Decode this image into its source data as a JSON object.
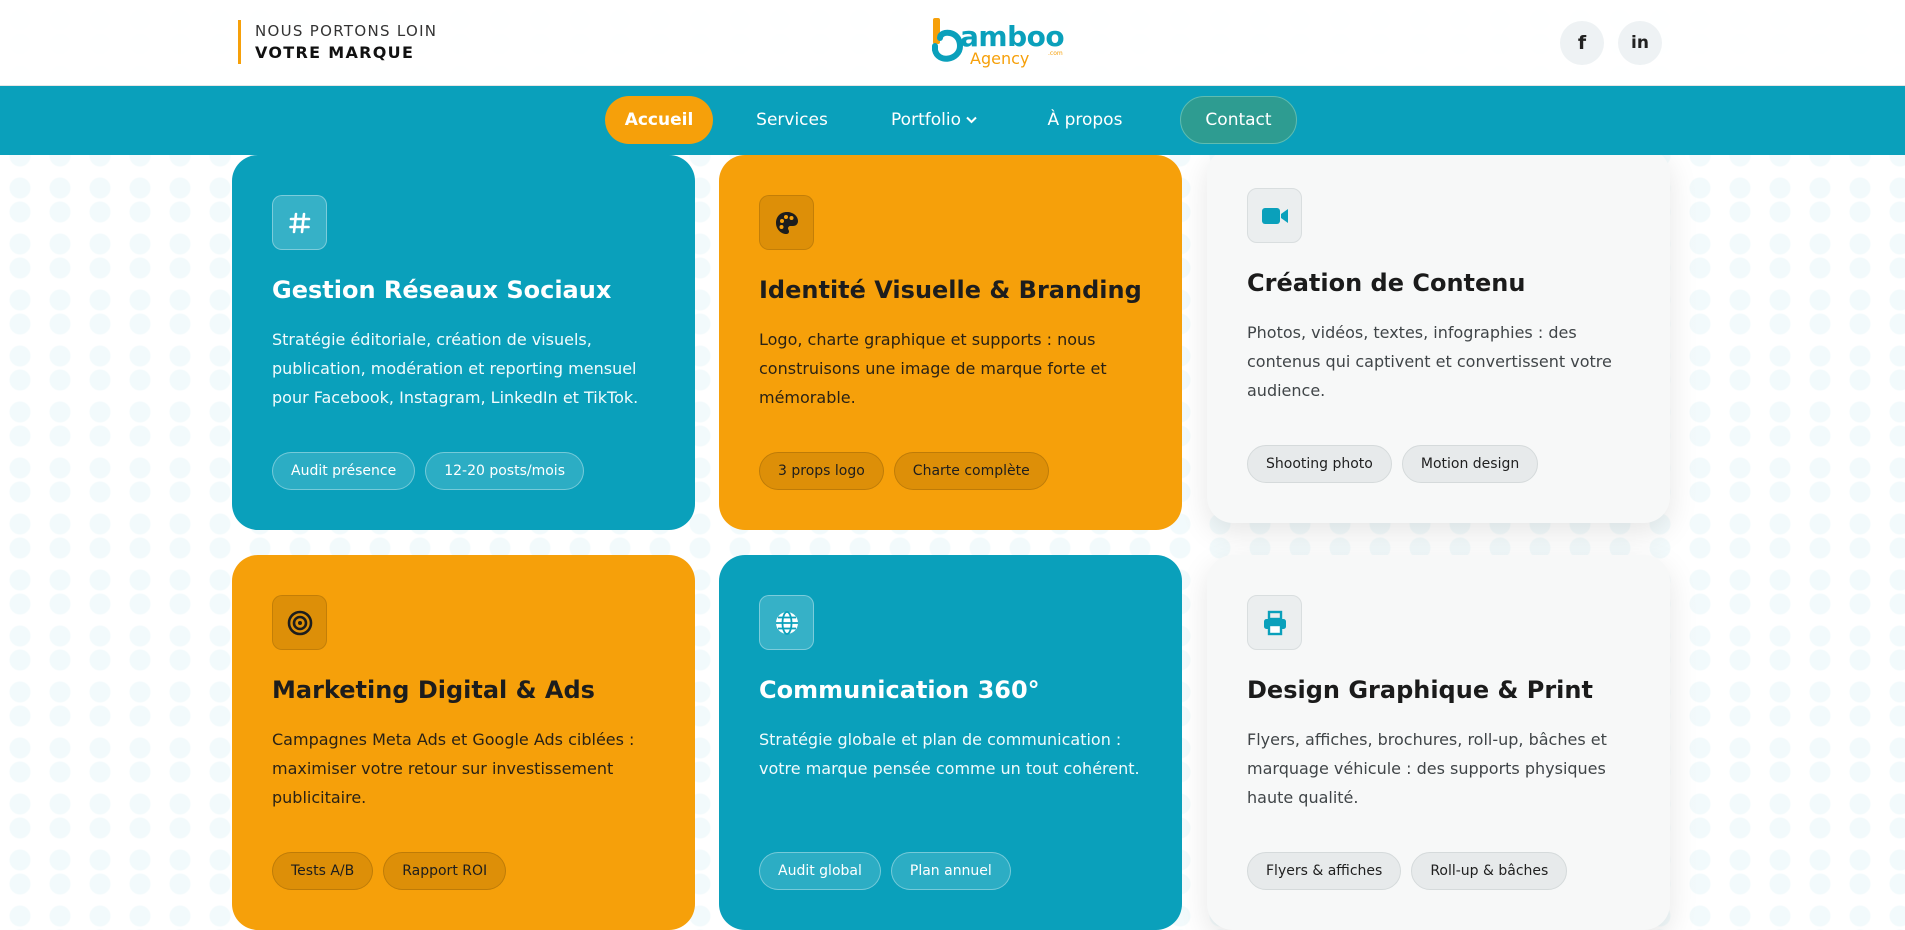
{
  "header": {
    "tagline_line1": "NOUS PORTONS LOIN",
    "tagline_line2": "VOTRE MARQUE",
    "logo_word": "amboo",
    "logo_sub": "Agency",
    "logo_com": ".com",
    "social": [
      {
        "label": "f",
        "icon": "facebook-icon"
      },
      {
        "label": "in",
        "icon": "linkedin-icon"
      }
    ]
  },
  "nav": {
    "items": [
      {
        "label": "Accueil",
        "active": true
      },
      {
        "label": "Services"
      },
      {
        "label": "Portfolio",
        "dropdown": true
      },
      {
        "label": "À propos"
      },
      {
        "label": "Contact",
        "style": "button"
      }
    ]
  },
  "colors": {
    "primary_blue": "#0aa0bb",
    "accent_orange": "#f6a00a",
    "contact_green": "#2e9c91"
  },
  "services": [
    {
      "icon": "hashtag-icon",
      "title": "Gestion Réseaux Sociaux",
      "description": "Stratégie éditoriale, création de visuels, publication, modération et reporting mensuel pour Facebook, Instagram, LinkedIn et TikTok.",
      "tags": [
        "Audit présence",
        "12-20 posts/mois"
      ]
    },
    {
      "icon": "palette-icon",
      "title": "Identité Visuelle & Branding",
      "description": "Logo, charte graphique et supports : nous construisons une image de marque forte et mémorable.",
      "tags": [
        "3 props logo",
        "Charte complète"
      ]
    },
    {
      "icon": "video-camera-icon",
      "title": "Création de Contenu",
      "description": "Photos, vidéos, textes, infographies : des contenus qui captivent et convertissent votre audience.",
      "tags": [
        "Shooting photo",
        "Motion design"
      ]
    },
    {
      "icon": "target-icon",
      "title": "Marketing Digital & Ads",
      "description": "Campagnes Meta Ads et Google Ads ciblées : maximiser votre retour sur investissement publicitaire.",
      "tags": [
        "Tests A/B",
        "Rapport ROI"
      ]
    },
    {
      "icon": "globe-icon",
      "title": "Communication 360°",
      "description": "Stratégie globale et plan de communication : votre marque pensée comme un tout cohérent.",
      "tags": [
        "Audit global",
        "Plan annuel"
      ]
    },
    {
      "icon": "printer-icon",
      "title": "Design Graphique & Print",
      "description": "Flyers, affiches, brochures, roll-up, bâches et marquage véhicule : des supports physiques haute qualité.",
      "tags": [
        "Flyers & affiches",
        "Roll-up & bâches"
      ]
    }
  ]
}
